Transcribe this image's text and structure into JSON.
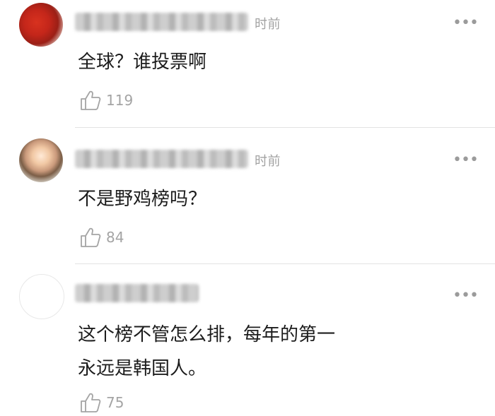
{
  "comments": [
    {
      "time_suffix": "时前",
      "more": "•••",
      "text": "全球？谁投票啊",
      "like_count": "119"
    },
    {
      "time_suffix": "时前",
      "more": "•••",
      "text": "不是野鸡榜吗？",
      "like_count": "84"
    },
    {
      "time_suffix": "",
      "more": "•••",
      "text": "这个榜不管怎么排，每年的第一永远是韩国人。",
      "like_count": "75"
    }
  ]
}
